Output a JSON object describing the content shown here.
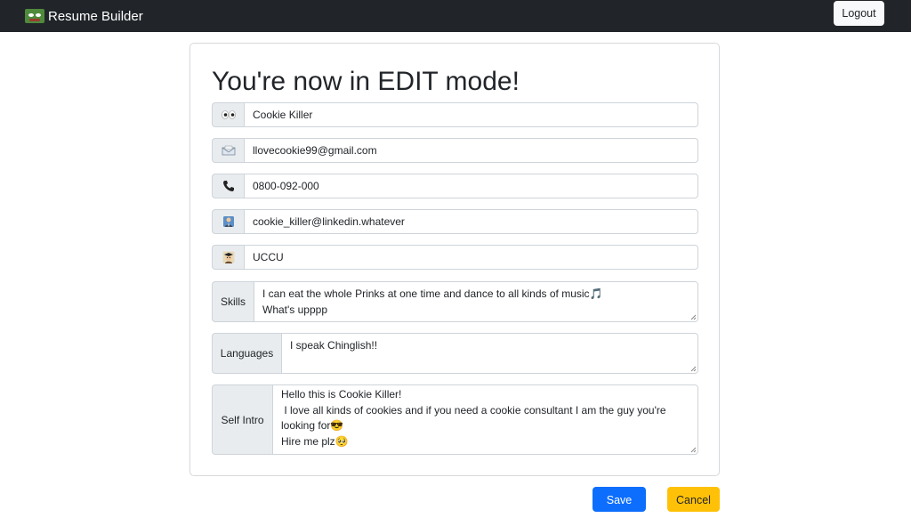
{
  "navbar": {
    "brand": "Resume Builder",
    "logo_icon": "pepe-frog-logo",
    "logout_label": "Logout"
  },
  "page_title": "You're now in EDIT mode!",
  "fields": {
    "name": {
      "icon": "eyes-icon",
      "value": "Cookie Killer"
    },
    "email": {
      "icon": "envelope-icon",
      "value": "llovecookie99@gmail.com"
    },
    "phone": {
      "icon": "telephone-icon",
      "value": "0800-092-000"
    },
    "linkedin": {
      "icon": "office-worker-icon",
      "value": "cookie_killer@linkedin.whatever"
    },
    "school": {
      "icon": "student-icon",
      "value": "UCCU"
    },
    "skills": {
      "label": "Skills",
      "value": "I can eat the whole Prinks at one time and dance to all kinds of music🎵\nWhat's upppp"
    },
    "languages": {
      "label": "Languages",
      "value": "I speak Chinglish!!"
    },
    "self_intro": {
      "label": "Self Intro",
      "value": "Hello this is Cookie Killer!\n I love all kinds of cookies and if you need a cookie consultant I am the guy you're looking for😎\nHire me plz🥺"
    }
  },
  "actions": {
    "save_label": "Save",
    "cancel_label": "Cancel"
  },
  "colors": {
    "navbar": "#212529",
    "primary": "#0d6efd",
    "warning": "#ffc107",
    "addon_bg": "#e9ecef",
    "border": "#ced4da"
  }
}
